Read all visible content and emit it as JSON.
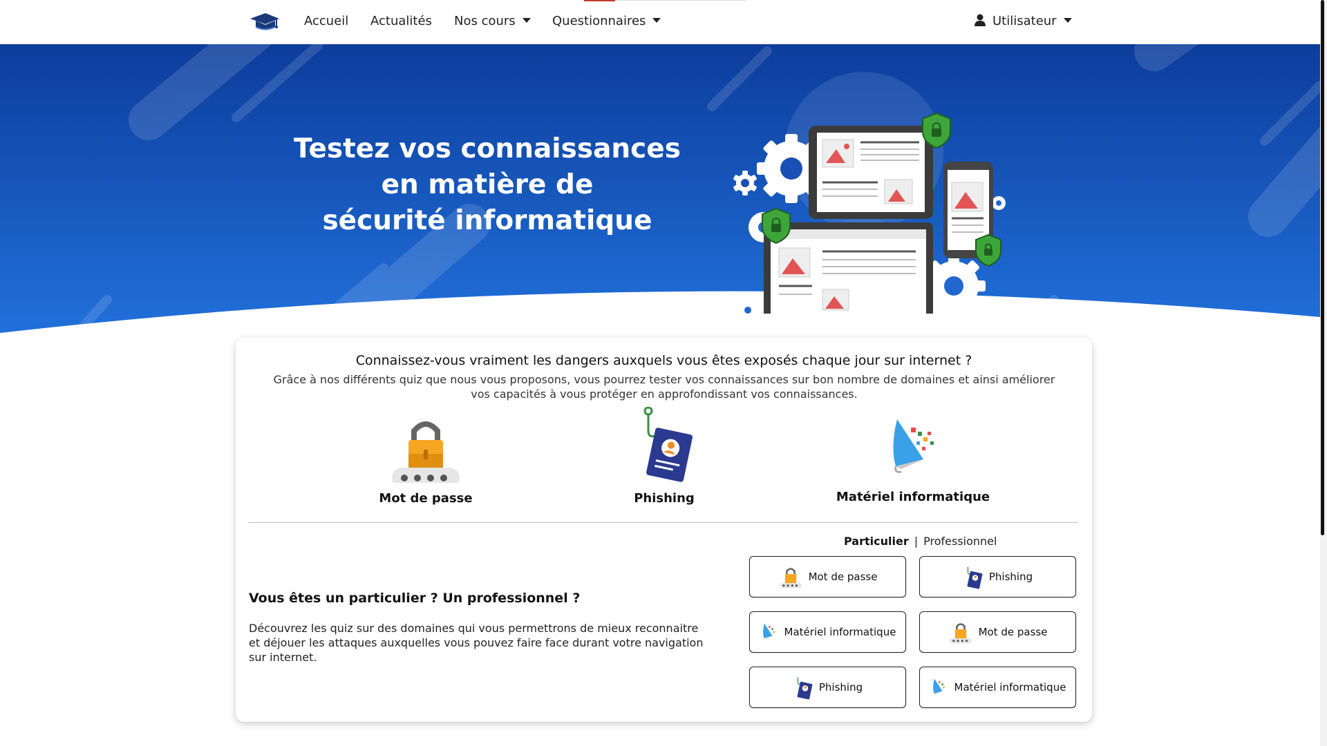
{
  "navbar": {
    "items": [
      {
        "label": "Accueil",
        "dropdown": false
      },
      {
        "label": "Actualités",
        "dropdown": false
      },
      {
        "label": "Nos cours",
        "dropdown": true
      },
      {
        "label": "Questionnaires",
        "dropdown": true
      }
    ],
    "user_label": "Utilisateur"
  },
  "hero": {
    "title_line1": "Testez vos connaissances",
    "title_line2": "en matière de",
    "title_line3": "sécurité informatique"
  },
  "card": {
    "heading": "Connaissez-vous vraiment les dangers auxquels vous êtes exposés chaque jour sur internet ?",
    "intro": "Grâce à nos différents quiz que nous vous proposons, vous pourrez tester vos connaissances sur bon nombre de domaines et ainsi améliorer vos capacités à vous protéger en approfondissant vos connaissances.",
    "features": [
      {
        "label": "Mot de passe",
        "icon": "padlock-password-icon"
      },
      {
        "label": "Phishing",
        "icon": "phishing-hook-icon"
      },
      {
        "label": "Matériel informatique",
        "icon": "hardware-cursor-icon"
      }
    ],
    "toggle": {
      "active": "Particulier",
      "separator": "|",
      "other": "Professionnel"
    },
    "subtitle": "Vous êtes un particulier ? Un professionnel ?",
    "subtext": "Découvrez les quiz sur des domaines qui vous permettrons de mieux reconnaitre et déjouer les attaques auxquelles vous pouvez faire face durant votre navigation sur internet.",
    "quiz_buttons": [
      {
        "label": "Mot de passe",
        "icon": "padlock-password-icon"
      },
      {
        "label": "Phishing",
        "icon": "phishing-hook-icon"
      },
      {
        "label": "Matériel informatique",
        "icon": "hardware-cursor-icon"
      },
      {
        "label": "Mot de passe",
        "icon": "padlock-password-icon"
      },
      {
        "label": "Phishing",
        "icon": "phishing-hook-icon"
      },
      {
        "label": "Matériel informatique",
        "icon": "hardware-cursor-icon"
      }
    ]
  },
  "colors": {
    "hero_top": "#0c3d9c",
    "hero_bottom": "#1f6ad6",
    "shield": "#3ea53a",
    "padlock": "#f5a623",
    "phishing_card": "#2b3a8f"
  }
}
